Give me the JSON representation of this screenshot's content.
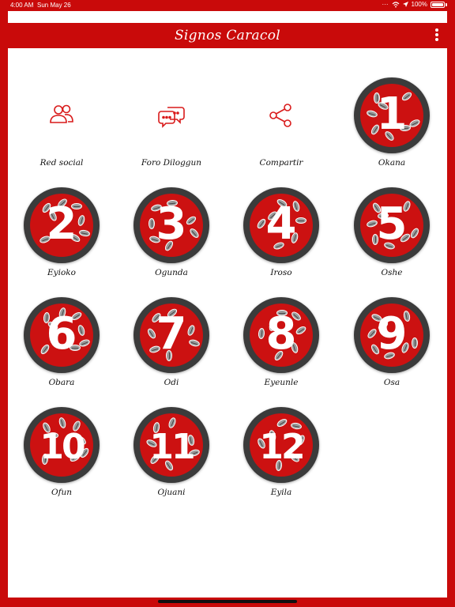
{
  "status_bar": {
    "time": "4:00 AM",
    "date": "Sun May 26",
    "battery": "100%"
  },
  "app": {
    "title": "Signos Caracol"
  },
  "actions": [
    {
      "label": "Red social",
      "icon": "users-icon"
    },
    {
      "label": "Foro Diloggun",
      "icon": "chat-bubbles-icon"
    },
    {
      "label": "Compartir",
      "icon": "share-icon"
    }
  ],
  "signs": [
    {
      "number": "1",
      "label": "Okana"
    },
    {
      "number": "2",
      "label": "Eyioko"
    },
    {
      "number": "3",
      "label": "Ogunda"
    },
    {
      "number": "4",
      "label": "Iroso"
    },
    {
      "number": "5",
      "label": "Oshe"
    },
    {
      "number": "6",
      "label": "Obara"
    },
    {
      "number": "7",
      "label": "Odi"
    },
    {
      "number": "8",
      "label": "Eyeunle"
    },
    {
      "number": "9",
      "label": "Osa"
    },
    {
      "number": "10",
      "label": "Ofun"
    },
    {
      "number": "11",
      "label": "Ojuani"
    },
    {
      "number": "12",
      "label": "Eyila"
    }
  ],
  "colors": {
    "brand_red": "#c90a0a",
    "ring_dark": "#3b3b3b"
  }
}
